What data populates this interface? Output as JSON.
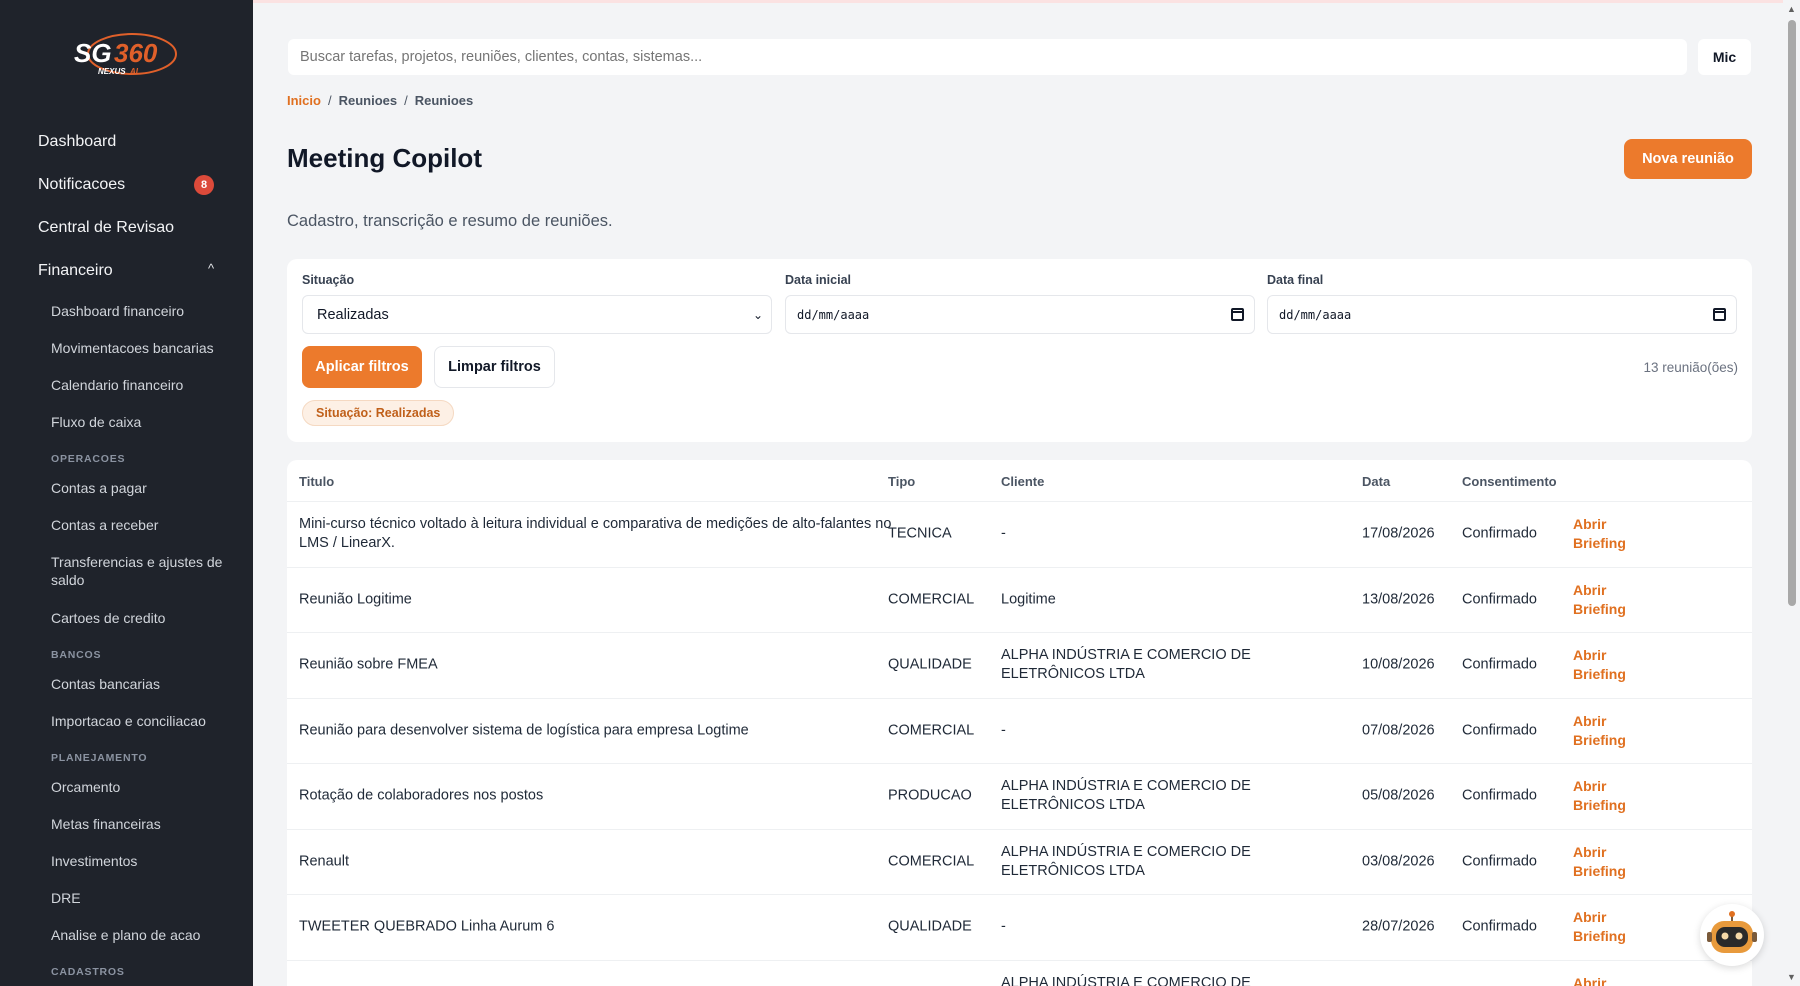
{
  "brand": {
    "logo_text": "SG360",
    "logo_subtext": "NEXUS AI",
    "accent": "#ec7a2c"
  },
  "search": {
    "placeholder": "Buscar tarefas, projetos, reuniões, clientes, contas, sistemas...",
    "mic_label": "Mic"
  },
  "sidebar": {
    "top_items": [
      {
        "label": "Dashboard"
      },
      {
        "label": "Notificacoes",
        "badge": "8"
      },
      {
        "label": "Central de Revisao"
      },
      {
        "label": "Financeiro",
        "caret": "^"
      }
    ],
    "financeiro_items": [
      "Dashboard financeiro",
      "Movimentacoes bancarias",
      "Calendario financeiro",
      "Fluxo de caixa"
    ],
    "sections": [
      {
        "title": "OPERACOES",
        "items": [
          "Contas a pagar",
          "Contas a receber",
          "Transferencias e ajustes de saldo",
          "Cartoes de credito"
        ]
      },
      {
        "title": "BANCOS",
        "items": [
          "Contas bancarias",
          "Importacao e conciliacao"
        ]
      },
      {
        "title": "PLANEJAMENTO",
        "items": [
          "Orcamento",
          "Metas financeiras",
          "Investimentos",
          "DRE",
          "Analise e plano de acao"
        ]
      },
      {
        "title": "CADASTROS",
        "items": []
      }
    ]
  },
  "breadcrumb": {
    "home": "Inicio",
    "sep": "/",
    "level1": "Reunioes",
    "level2": "Reunioes"
  },
  "page": {
    "title": "Meeting Copilot",
    "subtitle": "Cadastro, transcrição e resumo de reuniões.",
    "new_button": "Nova reunião"
  },
  "filters": {
    "situacao_label": "Situação",
    "situacao_value": "Realizadas",
    "data_inicial_label": "Data inicial",
    "data_inicial_value": "dd/mm/aaaa",
    "data_final_label": "Data final",
    "data_final_value": "dd/mm/aaaa",
    "apply_label": "Aplicar filtros",
    "clear_label": "Limpar filtros",
    "count_text": "13 reunião(ões)",
    "active_chip": "Situação: Realizadas"
  },
  "table": {
    "headers": {
      "titulo": "Titulo",
      "tipo": "Tipo",
      "cliente": "Cliente",
      "data": "Data",
      "consentimento": "Consentimento"
    },
    "rows": [
      {
        "titulo": "Mini-curso técnico voltado à leitura individual e comparativa de medições de alto-falantes no LMS / LinearX.",
        "tipo": "TECNICA",
        "cliente": "-",
        "data": "17/08/2026",
        "consentimento": "Confirmado",
        "acao": "Abrir Briefing"
      },
      {
        "titulo": "Reunião Logitime",
        "tipo": "COMERCIAL",
        "cliente": "Logitime",
        "data": "13/08/2026",
        "consentimento": "Confirmado",
        "acao": "Abrir Briefing"
      },
      {
        "titulo": "Reunião sobre FMEA",
        "tipo": "QUALIDADE",
        "cliente": "ALPHA INDÚSTRIA E COMERCIO DE ELETRÔNICOS LTDA",
        "data": "10/08/2026",
        "consentimento": "Confirmado",
        "acao": "Abrir Briefing"
      },
      {
        "titulo": "Reunião para desenvolver sistema de logística para empresa Logtime",
        "tipo": "COMERCIAL",
        "cliente": "-",
        "data": "07/08/2026",
        "consentimento": "Confirmado",
        "acao": "Abrir Briefing"
      },
      {
        "titulo": "Rotação de colaboradores nos postos",
        "tipo": "PRODUCAO",
        "cliente": "ALPHA INDÚSTRIA E COMERCIO DE ELETRÔNICOS LTDA",
        "data": "05/08/2026",
        "consentimento": "Confirmado",
        "acao": "Abrir Briefing"
      },
      {
        "titulo": "Renault",
        "tipo": "COMERCIAL",
        "cliente": "ALPHA INDÚSTRIA E COMERCIO DE ELETRÔNICOS LTDA",
        "data": "03/08/2026",
        "consentimento": "Confirmado",
        "acao": "Abrir Briefing"
      },
      {
        "titulo": "TWEETER QUEBRADO Linha Aurum 6",
        "tipo": "QUALIDADE",
        "cliente": "-",
        "data": "28/07/2026",
        "consentimento": "Confirmado",
        "acao": "Abrir Briefing"
      },
      {
        "titulo": "",
        "tipo": "",
        "cliente": "ALPHA INDÚSTRIA E COMERCIO DE ELETRÔNICOS LTDA",
        "data": "",
        "consentimento": "",
        "acao": "Abrir Briefing"
      }
    ]
  }
}
